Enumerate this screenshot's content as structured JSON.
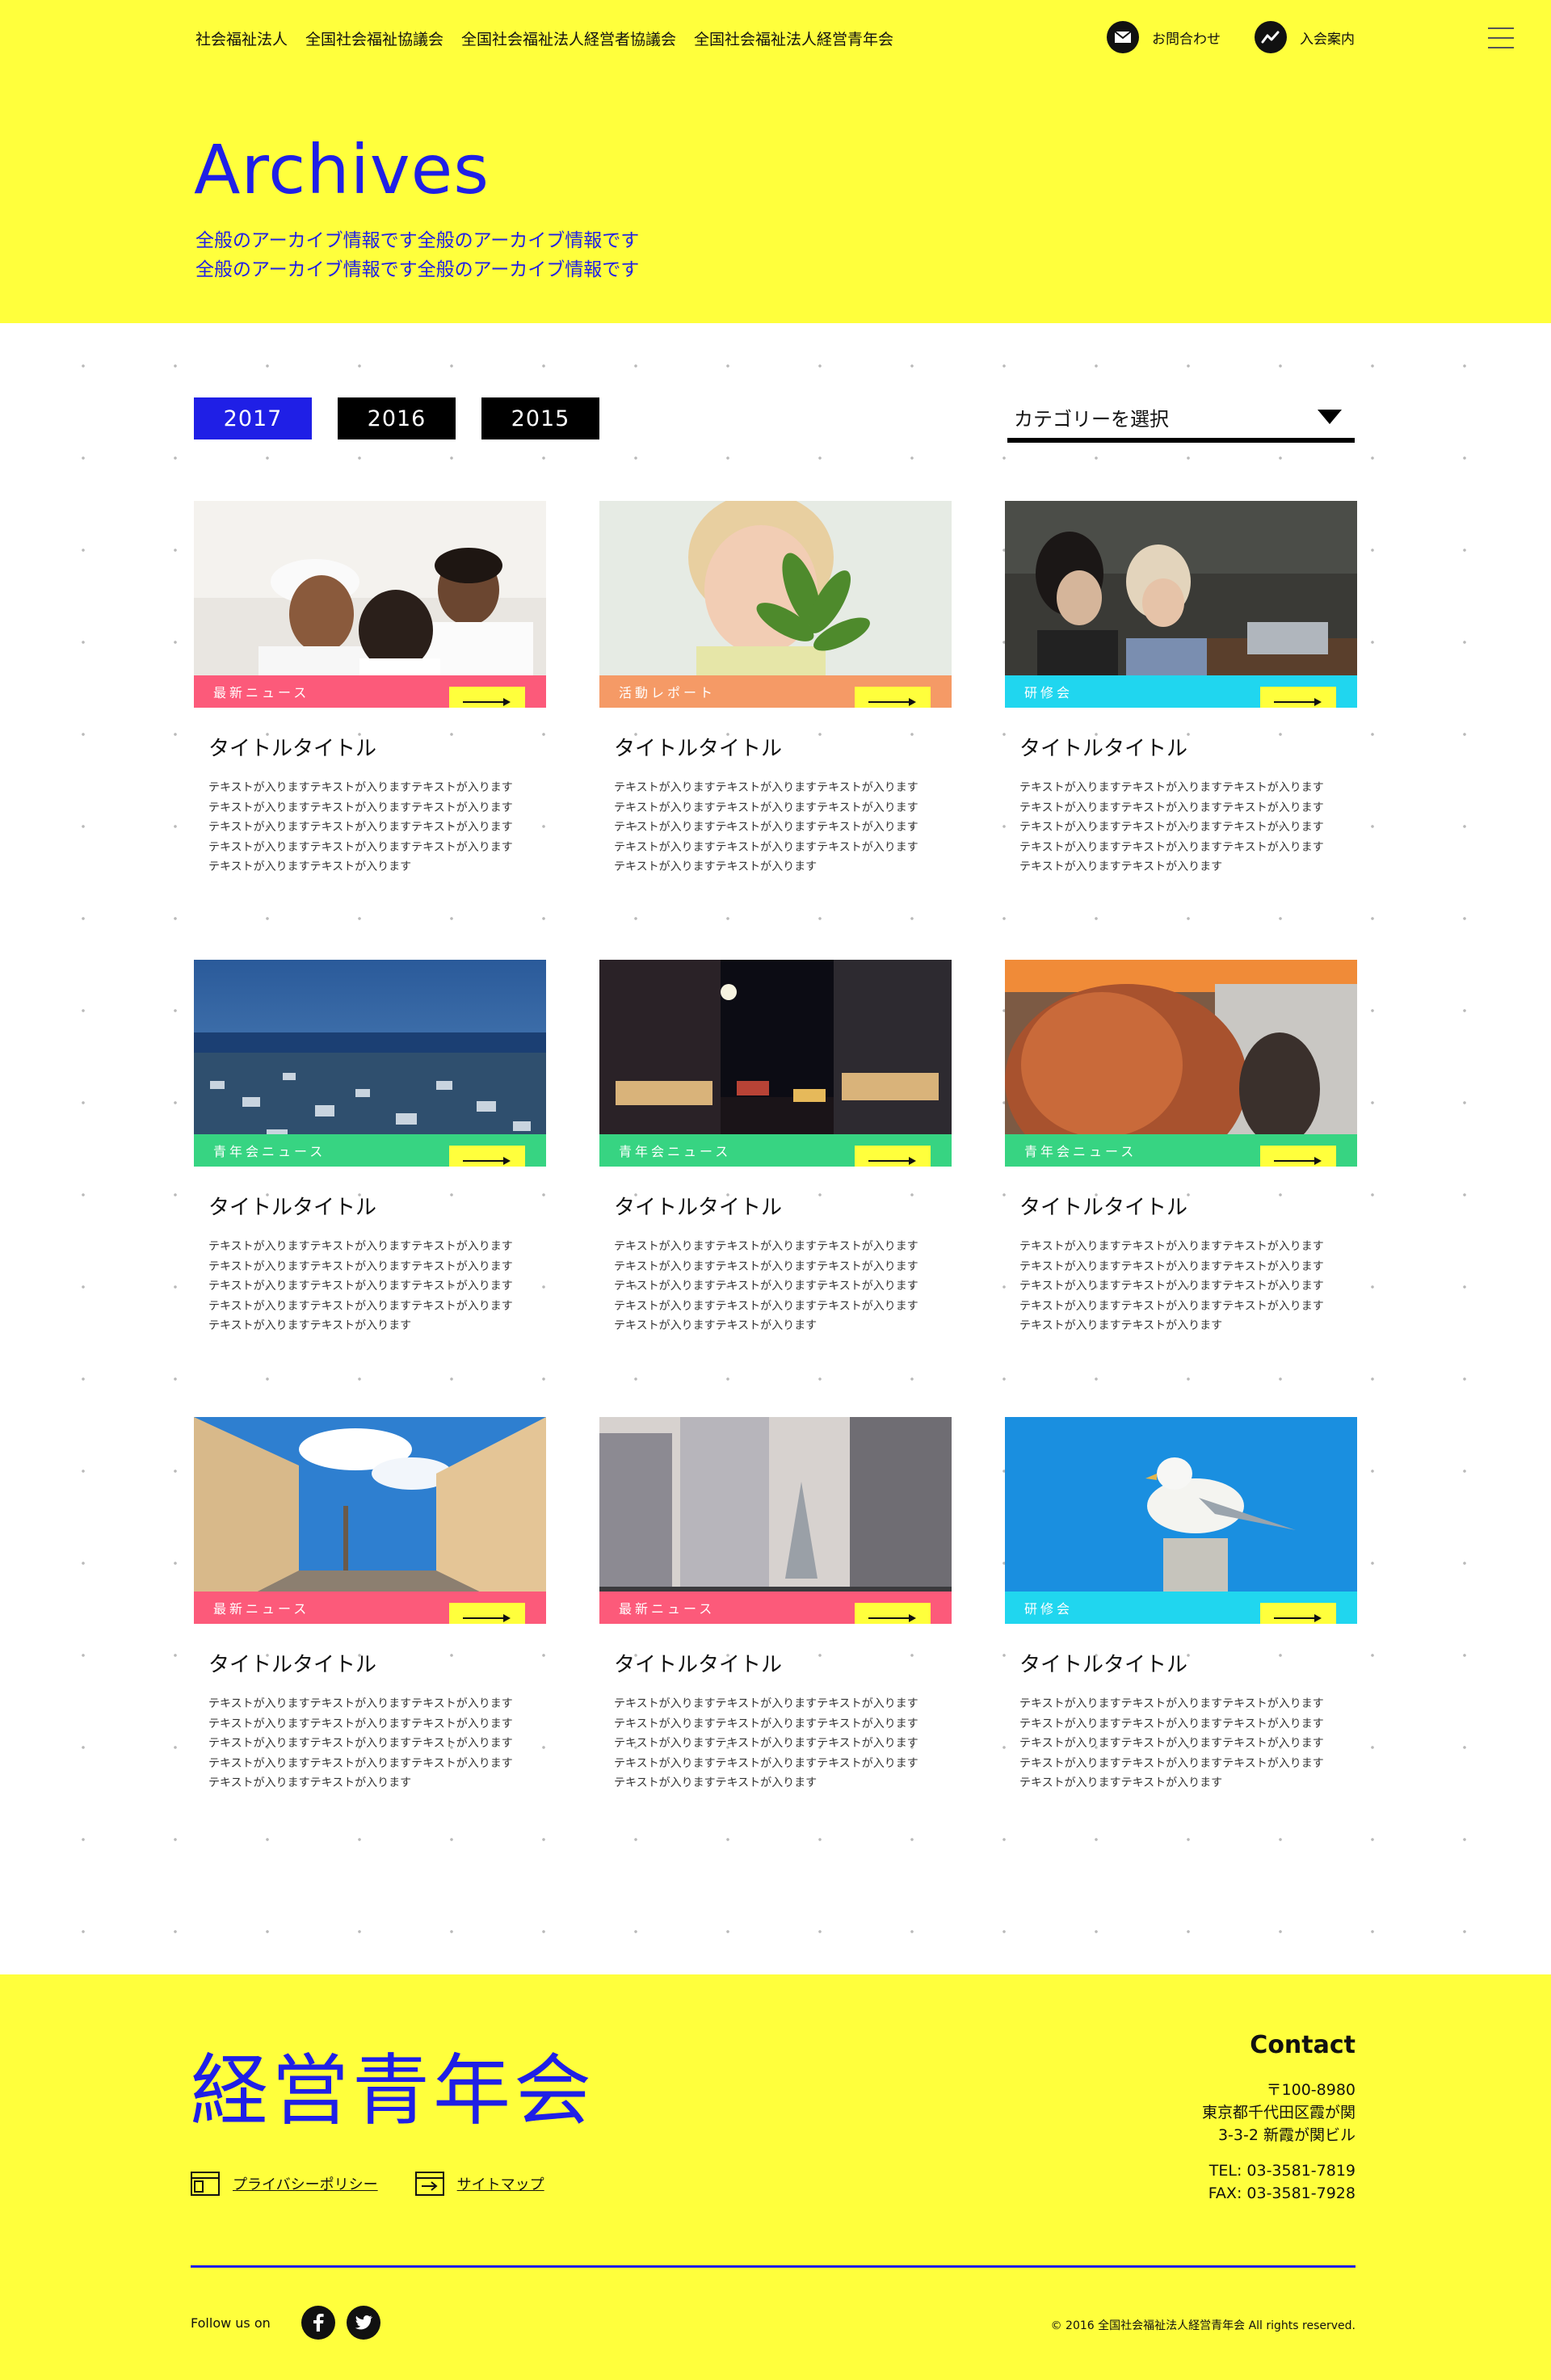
{
  "nav": {
    "links": [
      "社会福祉法人",
      "全国社会福祉協議会",
      "全国社会福祉法人経営者協議会",
      "全国社会福祉法人経営青年会"
    ],
    "contact_label": "お問合わせ",
    "join_label": "入会案内"
  },
  "hero": {
    "title": "Archives",
    "subtitle_1": "全般のアーカイブ情報です全般のアーカイブ情報です",
    "subtitle_2": "全般のアーカイブ情報です全般のアーカイブ情報です"
  },
  "filters": {
    "years": [
      "2017",
      "2016",
      "2015"
    ],
    "active_year": "2017",
    "category_placeholder": "カテゴリーを選択"
  },
  "cards": [
    {
      "category": "最新ニュース",
      "color": "pink",
      "title": "タイトルタイトル",
      "text": "テキストが入りますテキストが入りますテキストが入りますテキストが入りますテキストが入りますテキストが入りますテキストが入りますテキストが入りますテキストが入りますテキストが入りますテキストが入りますテキストが入りますテキストが入りますテキストが入ります"
    },
    {
      "category": "活動レポート",
      "color": "orange",
      "title": "タイトルタイトル",
      "text": "テキストが入りますテキストが入りますテキストが入りますテキストが入りますテキストが入りますテキストが入りますテキストが入りますテキストが入りますテキストが入りますテキストが入りますテキストが入りますテキストが入りますテキストが入りますテキストが入ります"
    },
    {
      "category": "研修会",
      "color": "cyan",
      "title": "タイトルタイトル",
      "text": "テキストが入りますテキストが入りますテキストが入りますテキストが入りますテキストが入りますテキストが入りますテキストが入りますテキストが入りますテキストが入りますテキストが入りますテキストが入りますテキストが入りますテキストが入りますテキストが入ります"
    },
    {
      "category": "青年会ニュース",
      "color": "green",
      "title": "タイトルタイトル",
      "text": "テキストが入りますテキストが入りますテキストが入りますテキストが入りますテキストが入りますテキストが入りますテキストが入りますテキストが入りますテキストが入りますテキストが入りますテキストが入りますテキストが入りますテキストが入りますテキストが入ります"
    },
    {
      "category": "青年会ニュース",
      "color": "green",
      "title": "タイトルタイトル",
      "text": "テキストが入りますテキストが入りますテキストが入りますテキストが入りますテキストが入りますテキストが入りますテキストが入りますテキストが入りますテキストが入りますテキストが入りますテキストが入りますテキストが入りますテキストが入りますテキストが入ります"
    },
    {
      "category": "青年会ニュース",
      "color": "green",
      "title": "タイトルタイトル",
      "text": "テキストが入りますテキストが入りますテキストが入りますテキストが入りますテキストが入りますテキストが入りますテキストが入りますテキストが入りますテキストが入りますテキストが入りますテキストが入りますテキストが入りますテキストが入りますテキストが入ります"
    },
    {
      "category": "最新ニュース",
      "color": "pink",
      "title": "タイトルタイトル",
      "text": "テキストが入りますテキストが入りますテキストが入りますテキストが入りますテキストが入りますテキストが入りますテキストが入りますテキストが入りますテキストが入りますテキストが入りますテキストが入りますテキストが入りますテキストが入りますテキストが入ります"
    },
    {
      "category": "最新ニュース",
      "color": "pink",
      "title": "タイトルタイトル",
      "text": "テキストが入りますテキストが入りますテキストが入りますテキストが入りますテキストが入りますテキストが入りますテキストが入りますテキストが入りますテキストが入りますテキストが入りますテキストが入りますテキストが入りますテキストが入りますテキストが入ります"
    },
    {
      "category": "研修会",
      "color": "cyan",
      "title": "タイトルタイトル",
      "text": "テキストが入りますテキストが入りますテキストが入りますテキストが入りますテキストが入りますテキストが入りますテキストが入りますテキストが入りますテキストが入りますテキストが入りますテキストが入りますテキストが入りますテキストが入りますテキストが入ります"
    }
  ],
  "footer": {
    "logo": "経営青年会",
    "privacy_label": "プライバシーポリシー",
    "sitemap_label": "サイトマップ",
    "contact_heading": "Contact",
    "postal": "〒100-8980",
    "address_1": "東京都千代田区霞が関",
    "address_2": "3-3-2 新霞が関ビル",
    "tel": "TEL: 03-3581-7819",
    "fax": "FAX: 03-3581-7928",
    "follow_label": "Follow us on",
    "copyright": "© 2016 全国社会福祉法人経営青年会 All rights reserved."
  },
  "colors": {
    "yellow": "#ffff3c",
    "blue": "#1f1fe6",
    "pink": "#fc5a7a",
    "orange": "#f59a66",
    "cyan": "#20d6ef",
    "green": "#37d482"
  },
  "icons": [
    "mail-icon",
    "chart-icon",
    "menu-icon",
    "arrow-right-icon",
    "window-icon",
    "sitemap-icon",
    "facebook-icon",
    "twitter-icon"
  ]
}
